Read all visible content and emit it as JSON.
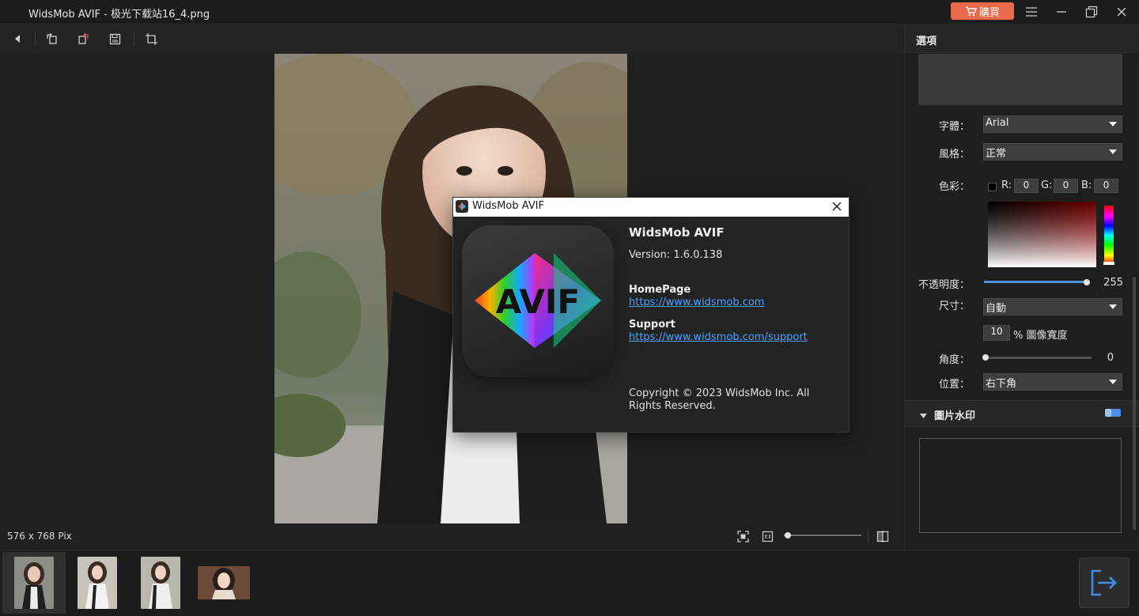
{
  "window": {
    "title": "WidsMob AVIF - 极光下载站16_4.png",
    "buy_label": "購買"
  },
  "canvas": {
    "dimensions": "576 x 768 Pix",
    "zoom_level": 0.05
  },
  "panel": {
    "title": "選項",
    "font_label": "字體：",
    "font_value": "Arial",
    "style_label": "風格：",
    "style_value": "正常",
    "color_label": "色彩：",
    "r_label": "R:",
    "r_value": "0",
    "g_label": "G:",
    "g_value": "0",
    "b_label": "B:",
    "b_value": "0",
    "opacity_label": "不透明度：",
    "opacity_value": "255",
    "opacity_fraction": 1.0,
    "size_label": "尺寸：",
    "size_value": "自動",
    "percent_value": "10",
    "percent_suffix": "% 圖像寬度",
    "angle_label": "角度：",
    "angle_value": "0",
    "position_label": "位置：",
    "position_value": "右下角",
    "image_watermark_label": "圖片水印"
  },
  "about": {
    "title": "WidsMob AVIF",
    "app_name": "WidsMob AVIF",
    "version": "Version: 1.6.0.138",
    "homepage_label": "HomePage",
    "homepage_url": "https://www.widsmob.com",
    "support_label": "Support",
    "support_url": "https://www.widsmob.com/support",
    "copyright": "Copyright © 2023 WidsMob Inc. All Rights Reserved.",
    "logo_text": "AVIF"
  },
  "thumbnails": [
    {
      "name": "thumb-1",
      "selected": true
    },
    {
      "name": "thumb-2",
      "selected": false
    },
    {
      "name": "thumb-3",
      "selected": false
    },
    {
      "name": "thumb-4",
      "selected": false
    }
  ],
  "icons": {
    "back": "back-arrow-icon",
    "rotate_left": "rotate-left-icon",
    "rotate_right": "rotate-right-icon",
    "save": "save-icon",
    "crop": "crop-icon",
    "fit": "fit-screen-icon",
    "actual_size": "actual-size-icon",
    "compare": "compare-icon",
    "export": "export-icon"
  }
}
